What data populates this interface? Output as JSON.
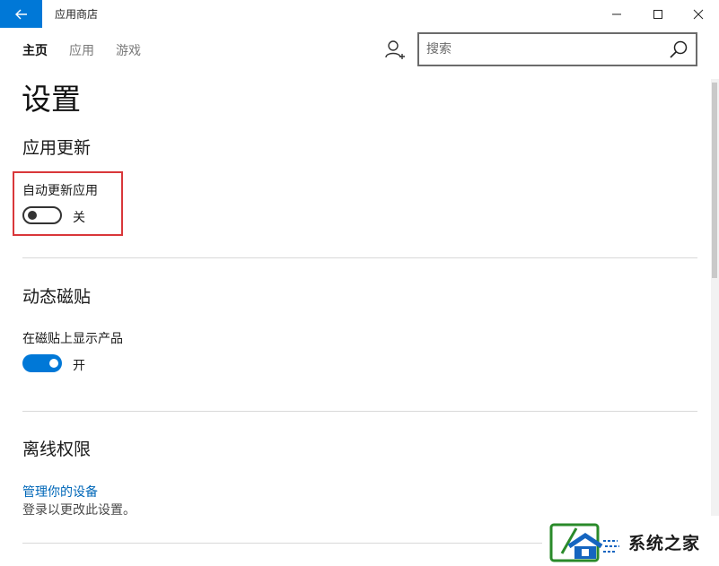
{
  "window": {
    "title": "应用商店",
    "accent": "#0078d7"
  },
  "nav": {
    "items": [
      {
        "label": "主页",
        "active": true
      },
      {
        "label": "应用",
        "active": false
      },
      {
        "label": "游戏",
        "active": false
      }
    ]
  },
  "search": {
    "placeholder": "搜索",
    "value": ""
  },
  "page": {
    "title": "设置"
  },
  "sections": {
    "app_updates": {
      "title": "应用更新",
      "setting_label": "自动更新应用",
      "toggle_state": "关",
      "toggle_on": false
    },
    "live_tiles": {
      "title": "动态磁贴",
      "setting_label": "在磁贴上显示产品",
      "toggle_state": "开",
      "toggle_on": true
    },
    "offline": {
      "title": "离线权限",
      "link_label": "管理你的设备",
      "hint": "登录以更改此设置。"
    }
  },
  "watermark": {
    "text": "系统之家"
  },
  "icons": {
    "back": "back-arrow-icon",
    "user": "user-add-icon",
    "search": "search-icon",
    "minimize": "minimize-icon",
    "maximize": "maximize-icon",
    "close": "close-icon"
  }
}
